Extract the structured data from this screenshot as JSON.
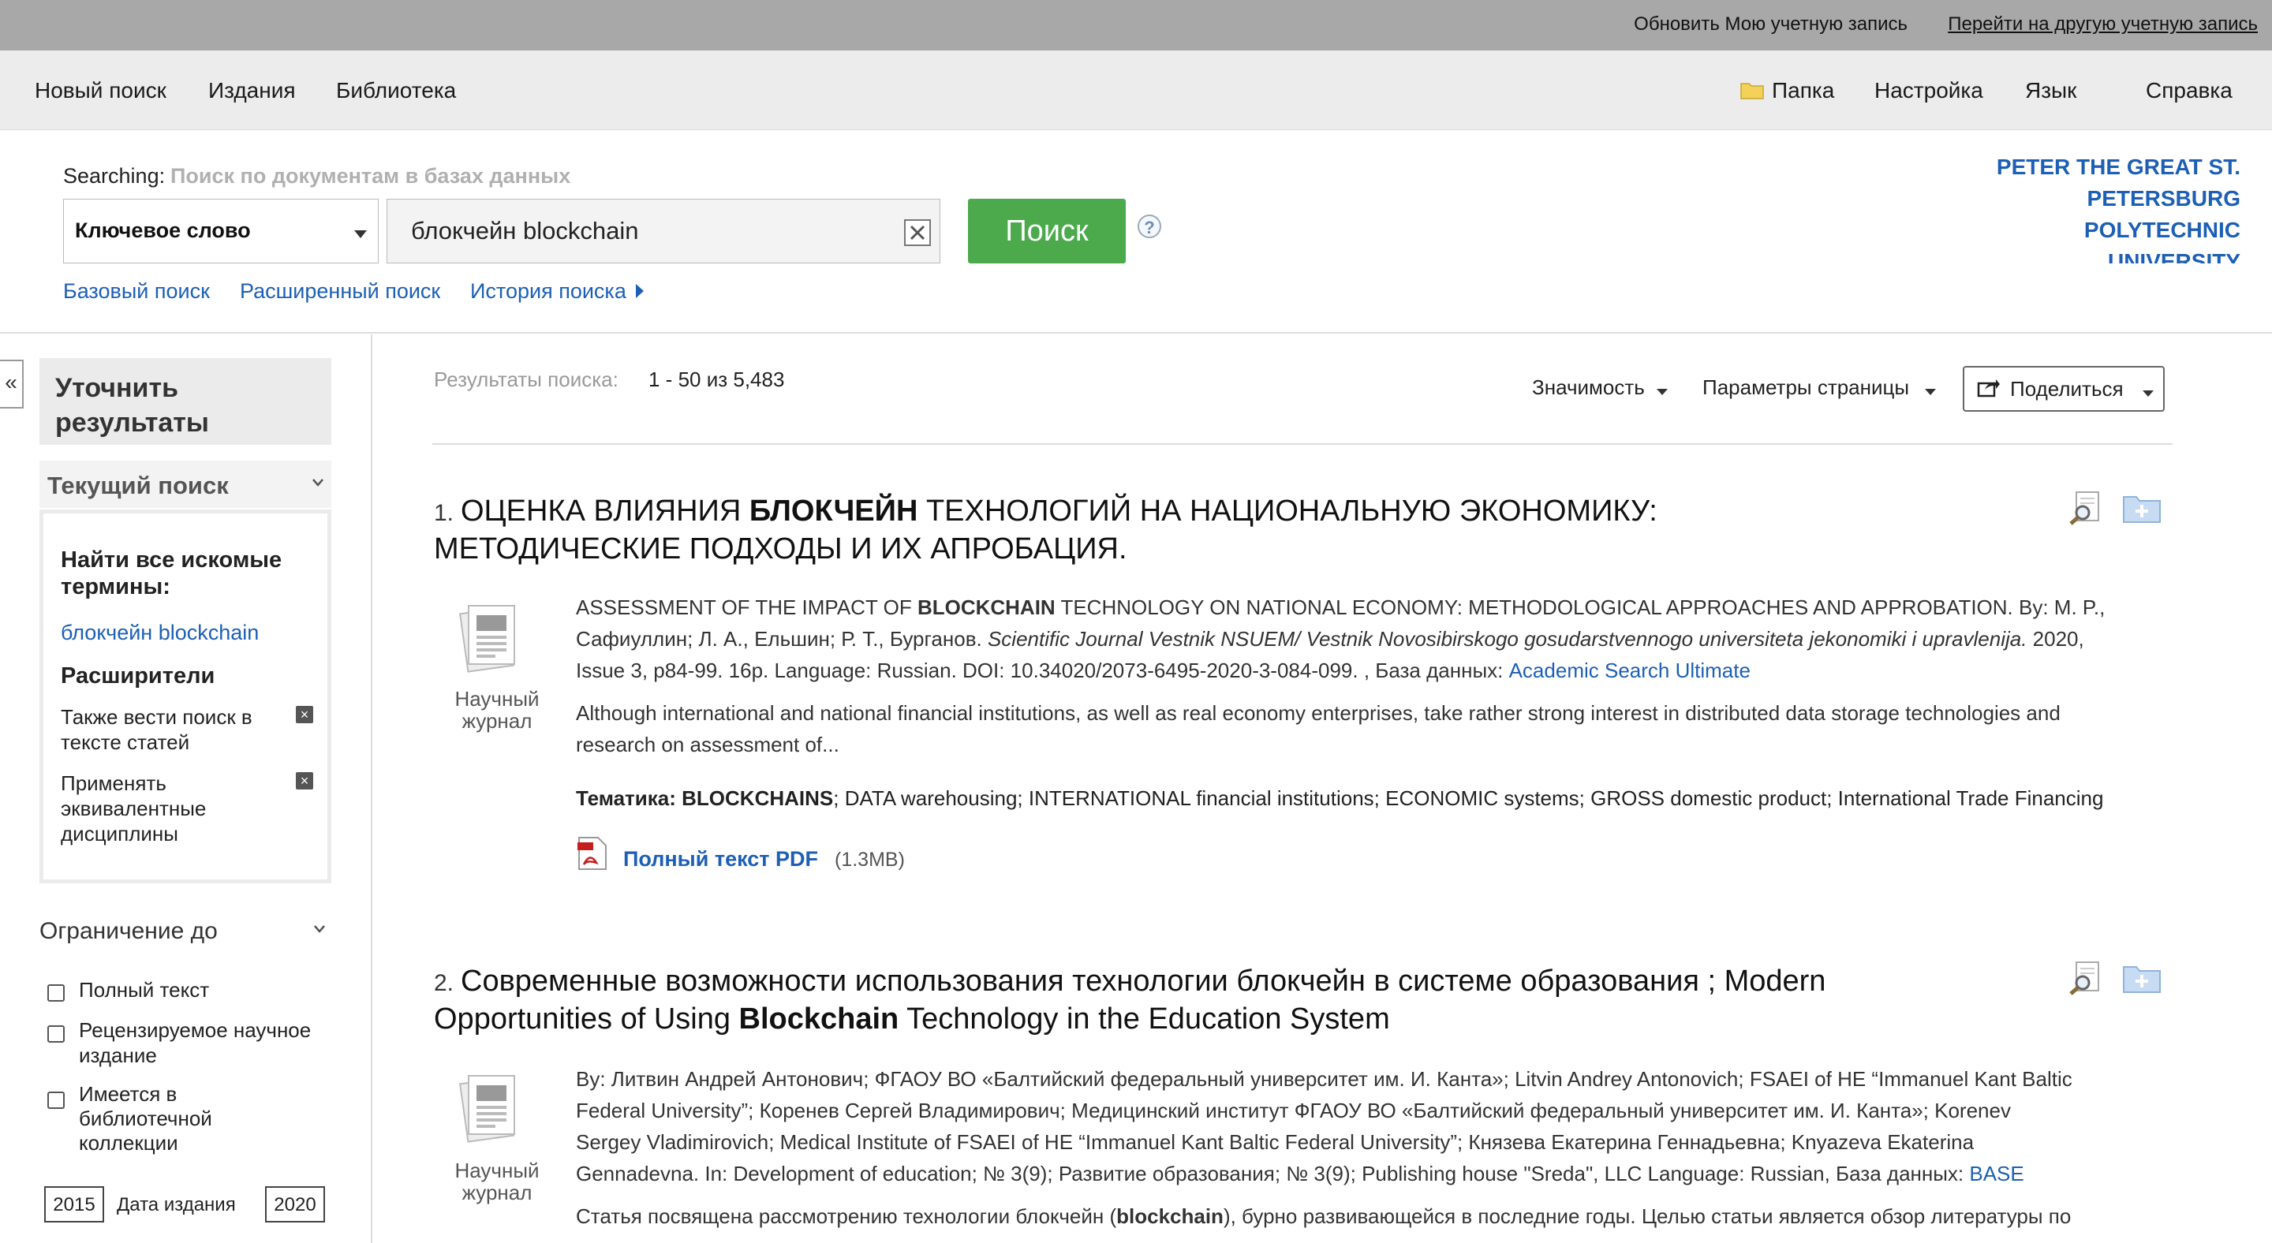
{
  "topbar": {
    "update_account": "Обновить Мою учетную запись",
    "switch_account": "Перейти на другую учетную запись"
  },
  "nav": {
    "new_search": "Новый поиск",
    "publications": "Издания",
    "library": "Библиотека",
    "folder": "Папка",
    "settings": "Настройка",
    "language": "Язык",
    "help": "Справка"
  },
  "search": {
    "searching_label": "Searching:",
    "searching_target": "Поиск по документам в базах данных",
    "field_select": "Ключевое слово",
    "query": "блокчейн blockchain",
    "button": "Поиск",
    "help_glyph": "?",
    "basic_link": "Базовый поиск",
    "advanced_link": "Расширенный поиск",
    "history_link": "История поиска"
  },
  "institution": {
    "line1": "PETER THE GREAT ST.",
    "line2": "PETERSBURG",
    "line3": "POLYTECHNIC",
    "line4": "UNIVERSITY"
  },
  "sidebar": {
    "collapse_glyph": "«",
    "refine_title_1": "Уточнить",
    "refine_title_2": "результаты",
    "current_search": "Текущий поиск",
    "find_all_terms_1": "Найти все искомые",
    "find_all_terms_2": "термины:",
    "terms": "блокчейн blockchain",
    "expanders": "Расширители",
    "expander_1_a": "Также вести поиск в",
    "expander_1_b": "тексте статей",
    "expander_2_a": "Применять",
    "expander_2_b": "эквивалентные",
    "expander_2_c": "дисциплины",
    "limit_title": "Ограничение до",
    "limit_fulltext": "Полный текст",
    "limit_peer_1": "Рецензируемое научное",
    "limit_peer_2": "издание",
    "limit_lib_1": "Имеется в",
    "limit_lib_2": "библиотечной",
    "limit_lib_3": "коллекции",
    "year_from": "2015",
    "year_label": "Дата издания",
    "year_to": "2020"
  },
  "results_header": {
    "label": "Результаты поиска:",
    "range": "1 - 50 из 5,483",
    "sort": "Значимость",
    "page_options": "Параметры страницы",
    "share": "Поделиться"
  },
  "results": [
    {
      "num": "1.",
      "title_pre": "ОЦЕНКА ВЛИЯНИЯ ",
      "title_bold": "БЛОКЧЕЙН",
      "title_post": " ТЕХНОЛОГИЙ НА НАЦИОНАЛЬНУЮ ЭКОНОМИКУ:",
      "title_line2": "МЕТОДИЧЕСКИЕ ПОДХОДЫ И ИХ АПРОБАЦИЯ.",
      "type_1": "Научный",
      "type_2": "журнал",
      "meta1_pre": "ASSESSMENT OF THE IMPACT OF ",
      "meta1_bold": "BLOCKCHAIN",
      "meta1_post": " TECHNOLOGY ON NATIONAL ECONOMY: METHODOLOGICAL APPROACHES AND APPROBATION. By: M. P.,",
      "meta2_pre": "Сафиуллин; Л. А., Ельшин; Р. Т., Бурганов. ",
      "meta2_italic": "Scientific Journal Vestnik NSUEM/ Vestnik Novosibirskogo gosudarstvennogo universiteta jekonomiki i upravlenija.",
      "meta2_post": " 2020,",
      "meta3_pre": "Issue 3, p84-99. 16p. Language: Russian. DOI: 10.34020/2073-6495-2020-3-084-099. , База данных: ",
      "meta3_db": "Academic Search Ultimate",
      "abstract1": "Although international and national financial institutions, as well as real economy enterprises, take rather strong interest in distributed data storage technologies and",
      "abstract2": "research on assessment of...",
      "subjects_label": "Тематика: ",
      "subjects_bold": "BLOCKCHAINS",
      "subjects_rest": "; DATA warehousing; INTERNATIONAL financial institutions; ECONOMIC systems; GROSS domestic product; International Trade Financing",
      "pdf_link": "Полный текст PDF",
      "pdf_size": "(1.3MB)"
    },
    {
      "num": "2.",
      "title_pre": "Современные возможности использования технологии блокчейн в системе образования ; Modern",
      "title_line2_pre": "Opportunities of Using ",
      "title_line2_bold": "Blockchain",
      "title_line2_post": " Technology in the Education System",
      "type_1": "Научный",
      "type_2": "журнал",
      "meta1": "By: Литвин Андрей Антонович; ФГАОУ ВО «Балтийский федеральный университет им. И. Канта»; Litvin Andrey Antonovich; FSAEI of HE “Immanuel Kant Baltic",
      "meta2": "Federal University”; Коренев Сергей Владимирович; Медицинский институт ФГАОУ ВО «Балтийский федеральный университет им. И. Канта»; Korenev",
      "meta3": "Sergey Vladimirovich; Medical Institute of FSAEI of HE “Immanuel Kant Baltic Federal University”; Князева Екатерина Геннадьевна; Knyazeva Ekaterina",
      "meta4_pre": "Gennadevna. In: Development of education; № 3(9); Развитие образования; № 3(9); Publishing house \"Sreda\", LLC Language: Russian, База данных: ",
      "meta4_db": "BASE",
      "abstract1_pre": "Статья посвящена рассмотрению технологии блокчейн (",
      "abstract1_bold": "blockchain",
      "abstract1_post": "), бурно развивающейся в последние годы. Целью статьи является обзор литературы по"
    }
  ]
}
